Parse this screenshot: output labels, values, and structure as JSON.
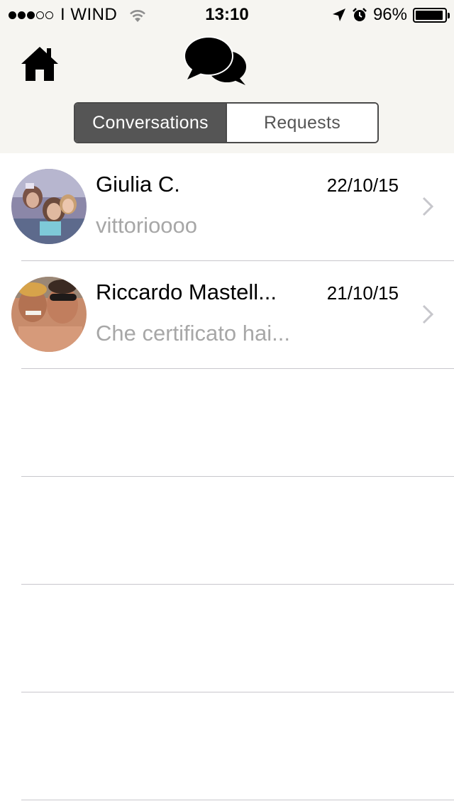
{
  "status_bar": {
    "signal_dots_filled": 3,
    "signal_dots_total": 5,
    "carrier": "I WIND",
    "time": "13:10",
    "battery_percent": "96%",
    "battery_level": 0.96,
    "icons": [
      "wifi-icon",
      "location-arrow-icon",
      "alarm-clock-icon",
      "battery-icon"
    ]
  },
  "nav": {
    "home_icon": "home-icon",
    "title_icon": "chat-bubbles-icon"
  },
  "tabs": [
    {
      "label": "Conversations",
      "active": true
    },
    {
      "label": "Requests",
      "active": false
    }
  ],
  "conversations": [
    {
      "name": "Giulia C.",
      "date": "22/10/15",
      "preview": "vittorioooo"
    },
    {
      "name": "Riccardo Mastell...",
      "date": "21/10/15",
      "preview": "Che certificato hai..."
    }
  ],
  "colors": {
    "header_bg": "#f6f5f1",
    "segment_active": "#555555",
    "preview_text": "#a7a7a7",
    "divider": "#c8c7cc"
  }
}
